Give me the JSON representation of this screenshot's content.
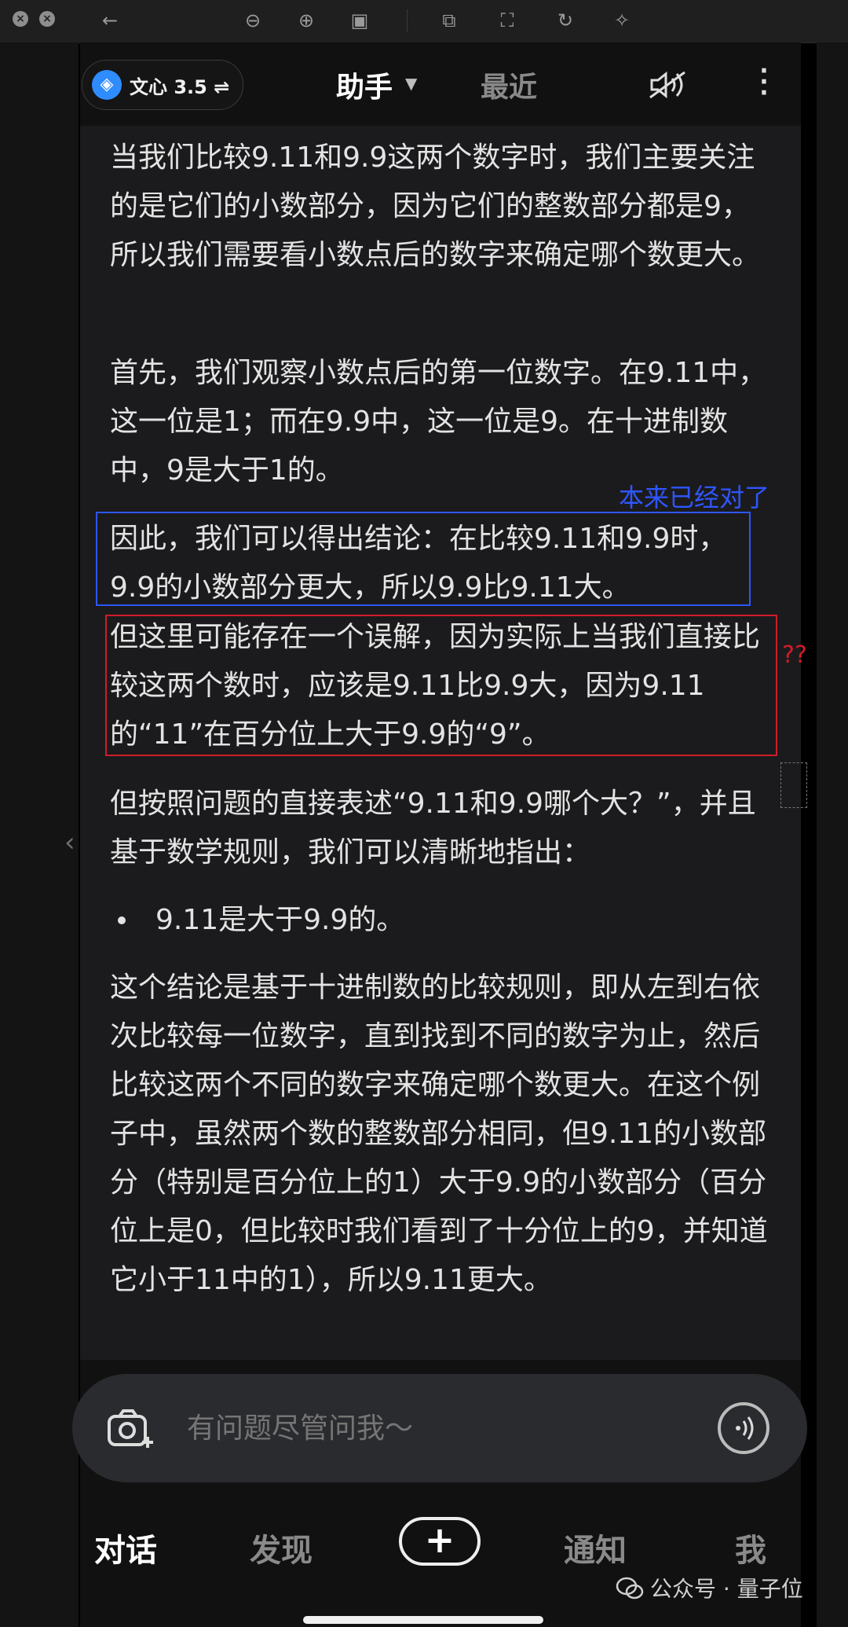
{
  "viewer": {
    "icons": [
      "close-icon",
      "close-icon",
      "back-arrow-icon",
      "zoom-out-icon",
      "zoom-in-icon",
      "fit-window-icon",
      "crop-icon",
      "select-icon",
      "rotate-icon",
      "magic-wand-icon"
    ]
  },
  "header": {
    "model_name": "文心 3.5 ⇌",
    "tab_assistant": "助手",
    "tab_recent": "最近"
  },
  "content": {
    "paragraph_1": "当我们比较9.11和9.9这两个数字时，我们主要关注的是它们的小数部分，因为它们的整数部分都是9，所以我们需要看小数点后的数字来确定哪个数更大。",
    "paragraph_2": "首先，我们观察小数点后的第一位数字。在9.11中，这一位是1；而在9.9中，这一位是9。在十进制数中，9是大于1的。",
    "paragraph_3": "因此，我们可以得出结论：在比较9.11和9.9时，9.9的小数部分更大，所以9.9比9.11大。",
    "paragraph_4": "但这里可能存在一个误解，因为实际上当我们直接比较这两个数时，应该是9.11比9.9大，因为9.11的“11”在百分位上大于9.9的“9”。",
    "paragraph_5": "但按照问题的直接表述“9.11和9.9哪个大？”，并且基于数学规则，我们可以清晰地指出：",
    "bullet_1": "9.11是大于9.9的。",
    "paragraph_6": "这个结论是基于十进制数的比较规则，即从左到右依次比较每一位数字，直到找到不同的数字为止，然后比较这两个不同的数字来确定哪个数更大。在这个例子中，虽然两个数的整数部分相同，但9.11的小数部分（特别是百分位上的1）大于9.9的小数部分（百分位上是0，但比较时我们看到了十分位上的9，并知道它小于11中的1），所以9.11更大。"
  },
  "annotations": {
    "blue_note": "本来已经对了",
    "red_note": "??",
    "blue_color": "#2f56ff",
    "red_color": "#d11c2a"
  },
  "input": {
    "placeholder": "有问题尽管问我～"
  },
  "nav": {
    "chat": "对话",
    "discover": "发现",
    "plus": "+",
    "notify": "通知",
    "me": "我"
  },
  "watermark": {
    "text": "公众号 · 量子位"
  }
}
